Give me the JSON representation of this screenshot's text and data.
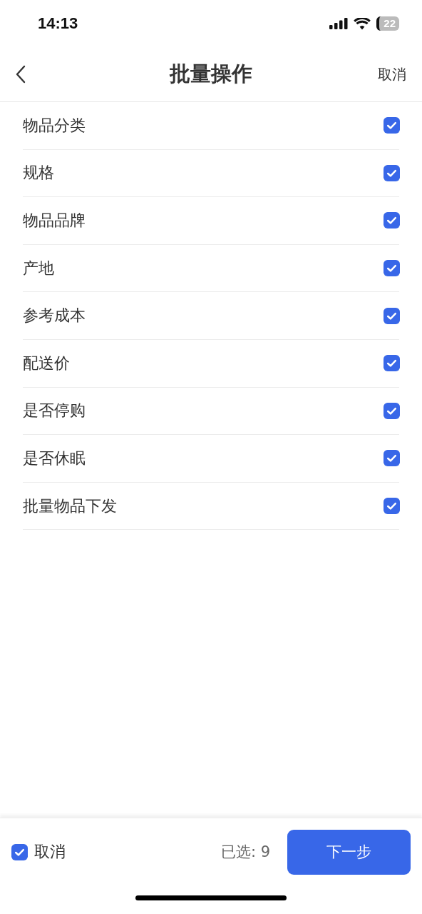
{
  "status_bar": {
    "time": "14:13",
    "battery": "22"
  },
  "nav": {
    "title": "批量操作",
    "action": "取消"
  },
  "items": [
    {
      "label": "物品分类",
      "checked": true
    },
    {
      "label": "规格",
      "checked": true
    },
    {
      "label": "物品品牌",
      "checked": true
    },
    {
      "label": "产地",
      "checked": true
    },
    {
      "label": "参考成本",
      "checked": true
    },
    {
      "label": "配送价",
      "checked": true
    },
    {
      "label": "是否停购",
      "checked": true
    },
    {
      "label": "是否休眠",
      "checked": true
    },
    {
      "label": "批量物品下发",
      "checked": true
    }
  ],
  "footer": {
    "select_all": {
      "label": "取消",
      "checked": true
    },
    "count": "已选: 9",
    "next": "下一步"
  }
}
